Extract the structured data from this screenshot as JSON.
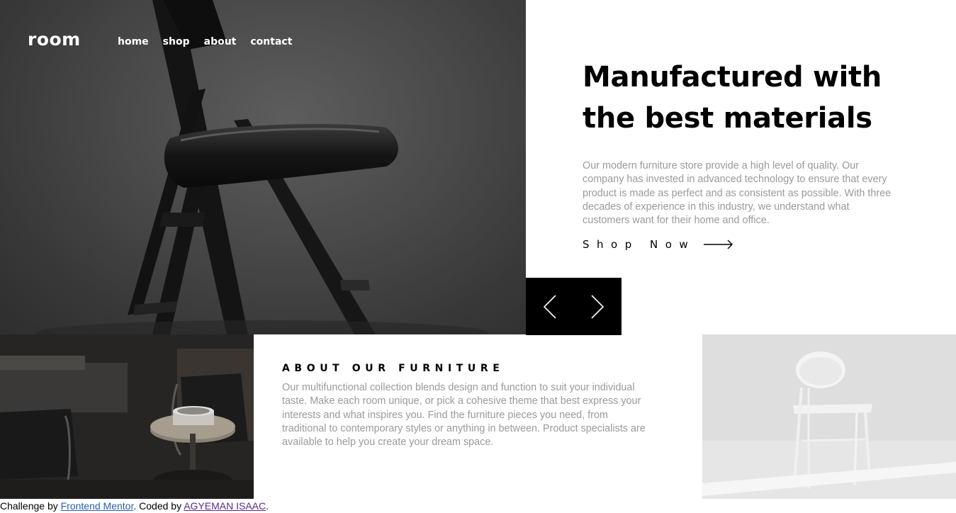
{
  "header": {
    "logo": "room",
    "nav": [
      "home",
      "shop",
      "about",
      "contact"
    ]
  },
  "hero": {
    "title_line1": "Manufactured with",
    "title_line2": "the best materials",
    "description": "Our modern furniture store provide a high level of quality. Our company has invested in advanced technology to ensure that every product is made as perfect and as consistent as possible. With three decades of experience in this industry, we understand what customers want for their home and office.",
    "cta_label": "Shop Now"
  },
  "about": {
    "title": "ABOUT OUR FURNITURE",
    "description": "Our multifunctional collection blends design and function to suit your individual taste. Make each room unique, or pick a cohesive theme that best express your interests and what inspires you. Find the furniture pieces you need, from traditional to contemporary styles or anything in between. Product specialists are available to help you create your dream space."
  },
  "attribution": {
    "prefix": "Challenge by ",
    "fm_link": "Frontend Mentor",
    "middle": ". Coded by ",
    "author_link": "AGYEMAN ISAAC",
    "suffix": "."
  },
  "icons": {
    "prev": "angle-left-icon",
    "next": "angle-right-icon",
    "cta_arrow": "arrow-right-icon"
  },
  "colors": {
    "text_dark": "#000000",
    "text_muted": "#9a9a9a",
    "control_bg": "#000000",
    "link_fm": "#2a5db0",
    "link_author": "#5a2b8c"
  }
}
